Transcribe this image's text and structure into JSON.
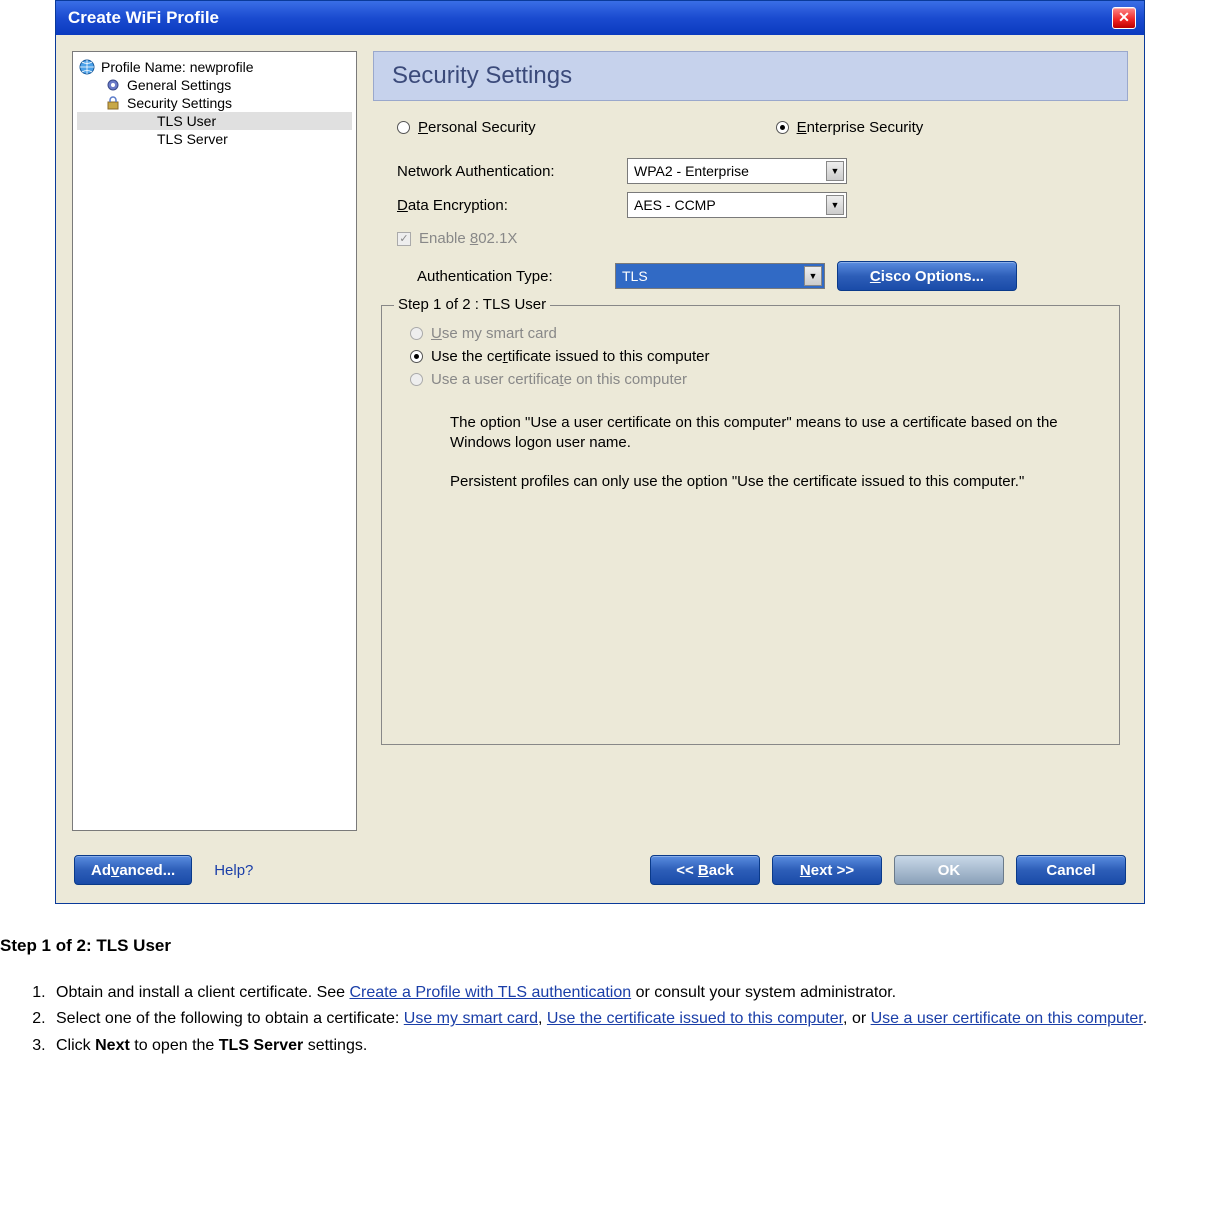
{
  "dialog": {
    "title": "Create WiFi Profile",
    "close": "✕"
  },
  "tree": {
    "profile_label": "Profile Name: newprofile",
    "general": "General Settings",
    "security": "Security Settings",
    "tls_user": "TLS User",
    "tls_server": "TLS Server"
  },
  "panel": {
    "header": "Security Settings",
    "radio_personal": "Personal Security",
    "radio_enterprise": "Enterprise Security",
    "netauth_label": "Network Authentication:",
    "netauth_value": "WPA2 - Enterprise",
    "dataenc_label": "Data Encryption:",
    "dataenc_value": "AES - CCMP",
    "enable_8021x": "Enable 802.1X",
    "authtype_label": "Authentication Type:",
    "authtype_value": "TLS",
    "cisco_btn": "Cisco Options..."
  },
  "fieldset": {
    "legend": "Step 1 of 2 : TLS User",
    "opt_smart": "Use my smart card",
    "opt_cert_comp": "Use the certificate issued to this computer",
    "opt_cert_user": "Use a user certificate on this computer",
    "explain1": "The option \"Use a user certificate on this computer\" means to use a certificate based on the Windows logon user name.",
    "explain2": "Persistent profiles can only use the option \"Use the certificate issued to this computer.\""
  },
  "footer": {
    "advanced": "Advanced...",
    "help": "Help?",
    "back": "<< Back",
    "next": "Next >>",
    "ok": "OK",
    "cancel": "Cancel"
  },
  "doc": {
    "heading": "Step 1 of 2: TLS User",
    "li1a": "Obtain and install a client certificate. See ",
    "li1_link": "Create a Profile with TLS authentication",
    "li1b": " or consult your system administrator.",
    "li2a": "Select one of the following to obtain a certificate: ",
    "li2_link1": "Use my smart card",
    "li2b": ", ",
    "li2_link2": "Use the certificate issued to this computer",
    "li2c": ", or ",
    "li2_link3": "Use a user certificate on this computer",
    "li2d": ".",
    "li3a": "Click ",
    "li3_bold1": "Next",
    "li3b": " to open the ",
    "li3_bold2": "TLS Server",
    "li3c": " settings."
  }
}
